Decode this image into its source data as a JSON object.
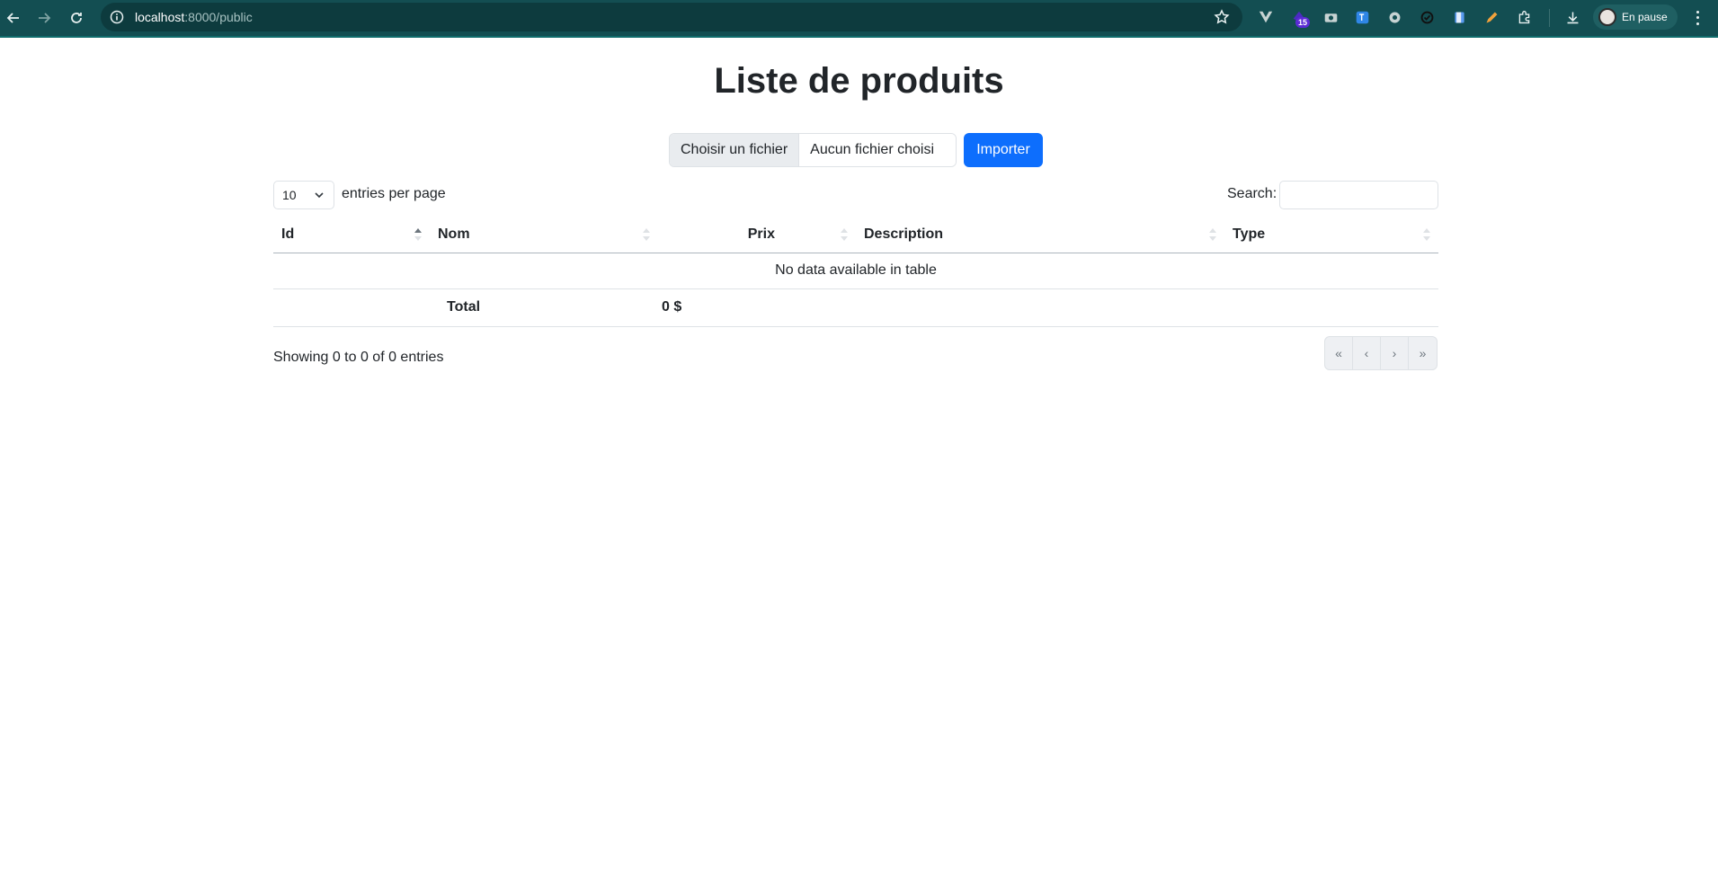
{
  "browser": {
    "url_host": "localhost",
    "url_path": ":8000/public",
    "extension_badge": "15",
    "profile_label": "En pause"
  },
  "page": {
    "title": "Liste de produits",
    "file_choose_label": "Choisir un fichier",
    "file_none_label": "Aucun fichier choisi",
    "import_button": "Importer"
  },
  "datatable": {
    "page_length": "10",
    "length_label": "entries per page",
    "search_label": "Search:",
    "search_value": "",
    "columns": [
      "Id",
      "Nom",
      "Prix",
      "Description",
      "Type"
    ],
    "empty_message": "No data available in table",
    "footer_total_label": "Total",
    "footer_total_value": "0 $",
    "info": "Showing 0 to 0 of 0 entries",
    "pager": [
      "«",
      "‹",
      "›",
      "»"
    ]
  }
}
